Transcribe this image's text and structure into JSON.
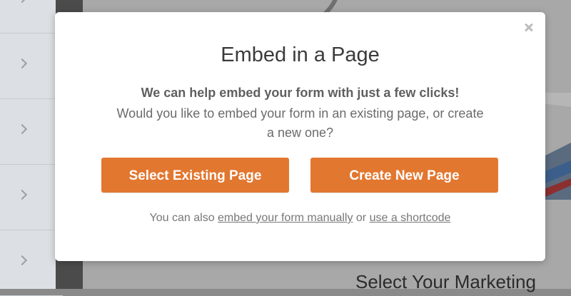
{
  "background": {
    "heading": "Select Your Marketing"
  },
  "modal": {
    "title": "Embed in a Page",
    "lead": "We can help embed your form with just a few clicks!",
    "question": "Would you like to embed your form in an existing page, or create a new one?",
    "buttons": {
      "select_existing": "Select Existing Page",
      "create_new": "Create New Page"
    },
    "footer": {
      "prefix": "You can also ",
      "manual_link": "embed your form manually",
      "middle": " or ",
      "shortcode_link": "use a shortcode"
    },
    "close_icon": "close-icon"
  },
  "colors": {
    "button_bg": "#e27730",
    "button_text": "#ffffff",
    "overlay": "#8a8a8a"
  }
}
